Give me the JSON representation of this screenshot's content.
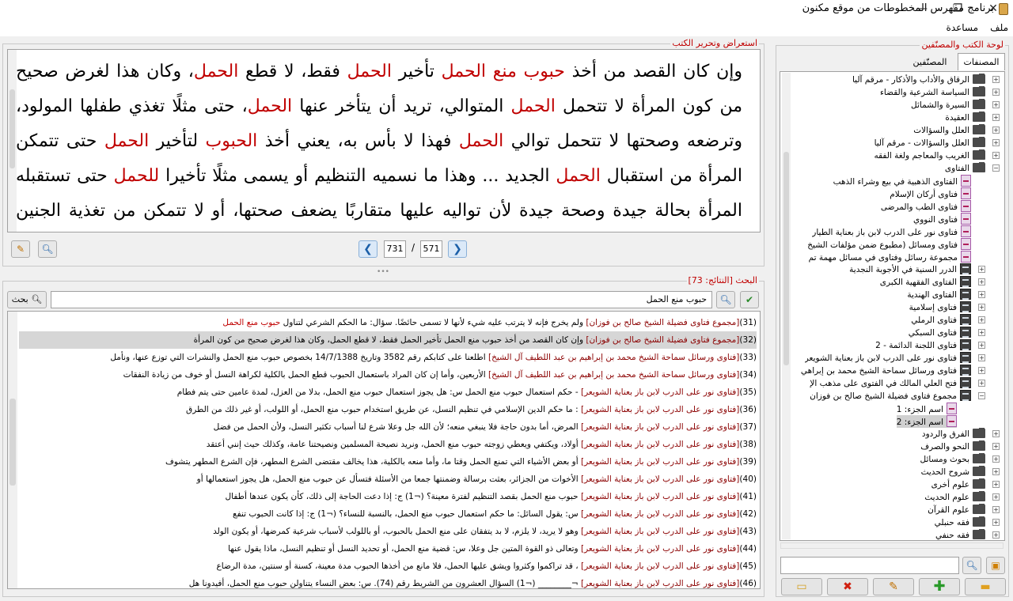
{
  "window": {
    "title": "برنامج مفهرس المخطوطات من موقع مكنون",
    "minimize": "—",
    "maximize": "❐",
    "close": "✕"
  },
  "menu": [
    "ملف",
    "مساعدة"
  ],
  "viewer": {
    "legend": "استعراض وتحرير الكتب",
    "paragraph": [
      {
        "t": "وإن كان القصد من أخذ "
      },
      {
        "t": "حبوب منع الحمل",
        "h": 1
      },
      {
        "t": " تأخير "
      },
      {
        "t": "الحمل",
        "h": 1
      },
      {
        "t": " فقط، لا قطع "
      },
      {
        "t": "الحمل",
        "h": 1
      },
      {
        "t": "، وكان هذا لغرض صحيح من كون المرأة لا تتحمل "
      },
      {
        "t": "الحمل",
        "h": 1
      },
      {
        "t": " المتوالي، تريد أن يتأخر عنها "
      },
      {
        "t": "الحمل",
        "h": 1
      },
      {
        "t": "، حتى مثلًا تغذي طفلها المولود، وترضعه وصحتها لا تتحمل توالي "
      },
      {
        "t": "الحمل",
        "h": 1
      },
      {
        "t": " فهذا لا بأس به، يعني أخذ "
      },
      {
        "t": "الحبوب",
        "h": 1
      },
      {
        "t": " لتأخير "
      },
      {
        "t": "الحمل",
        "h": 1
      },
      {
        "t": " حتى تتمكن المرأة من استقبال "
      },
      {
        "t": "الحمل",
        "h": 1
      },
      {
        "t": " الجديد ... وهذا ما نسميه التنظيم أو يسمى مثلًا تأخيرا "
      },
      {
        "t": "للحمل",
        "h": 1
      },
      {
        "t": " حتى تستقبله المرأة بحالة جيدة وصحة جيدة لأن تواليه عليها متقاربًا يضعف صحتها، أو لا تتمكن من تغذية الجنين التغذية المطلوبة، ففي هذه الحالة جائز ولا بأس به."
      }
    ],
    "page_current": "571",
    "page_sep": "/",
    "page_total": "731"
  },
  "search": {
    "legend": "البحث [النتائج: 73]",
    "query": "حبوب منع الحمل",
    "button_label": "بحث",
    "results": [
      {
        "n": "(31)",
        "src": "[مجموع فتاوى فضيلة الشيخ صالح بن فوزان]",
        "t": " ولم يخرج فإنه لا يترتب عليه شيء لأنها لا تسمى حائضًا. سؤال: ما الحكم الشرعي لتناول ",
        "k": "حبوب منع الحمل"
      },
      {
        "n": "(32)",
        "src": "[مجموع فتاوى فضيلة الشيخ صالح بن فوزان]",
        "t": " وإن كان القصد من أخذ حبوب منع الحمل تأخير الحمل فقط، لا قطع الحمل، وكان هذا لغرض صحيح من كون المرأة",
        "k": "",
        "sel": 1
      },
      {
        "n": "(33)",
        "src": "[فتاوى ورسائل سماحة الشيخ محمد بن إبراهيم بن عبد اللطيف آل الشيخ]",
        "t": " اطلعنا على كتابكم رقم 3582 وتاريخ 14/7/1388 بخصوص حبوب منع الحمل والنشرات التي توزع عنها، ونأمل",
        "k": ""
      },
      {
        "n": "(34)",
        "src": "[فتاوى ورسائل سماحة الشيخ محمد بن إبراهيم بن عبد اللطيف آل الشيخ]",
        "t": " الأربعين، وأما إن كان المراد باستعمال الحبوب قطع الحمل بالكلية لكراهة النسل أو خوف من زيادة النفقات",
        "k": ""
      },
      {
        "n": "(35)",
        "src": "[فتاوى نور على الدرب لابن باز بعناية الشويعر]",
        "t": " - حكم استعمال حبوب منع الحمل س: هل يجوز استعمال حبوب منع الحمل، بدلا من العزل، لمدة عامين حتى يتم فطام",
        "k": ""
      },
      {
        "n": "(36)",
        "src": "[فتاوى نور على الدرب لابن باز بعناية الشويعر]",
        "t": " : ما حكم الدين الإسلامي في تنظيم النسل، عن طريق استخدام حبوب منع الحمل، أو اللولب، أو غير ذلك من الطرق",
        "k": ""
      },
      {
        "n": "(37)",
        "src": "[فتاوى نور على الدرب لابن باز بعناية الشويعر]",
        "t": " المرض، أما بدون حاجة فلا ينبغي منعه؛ لأن الله جل وعلا شرع لنا أسباب تكثير النسل، ولأن الحمل من فضل",
        "k": ""
      },
      {
        "n": "(38)",
        "src": "[فتاوى نور على الدرب لابن باز بعناية الشويعر]",
        "t": " أولاد، ويكتفي ويعطي زوجته حبوب منع الحمل، ونريد نصيحة المسلمين ونصيحتنا عامة، وكذلك حيث إنني أعتقد",
        "k": ""
      },
      {
        "n": "(39)",
        "src": "[فتاوى نور على الدرب لابن باز بعناية الشويعر]",
        "t": " أو بعض الأشياء التي تمنع الحمل وقتا ما، وأما منعه بالكلية، هذا يخالف مقتضى الشرع المطهر، فإن الشرع المطهر يتشوف",
        "k": ""
      },
      {
        "n": "(40)",
        "src": "[فتاوى نور على الدرب لابن باز بعناية الشويعر]",
        "t": " الأخوات من الجزائر، بعثت برسالة وضمنتها جمعا من الأسئلة فتسأل عن حبوب منع الحمل، هل يجوز استعمالها أو",
        "k": ""
      },
      {
        "n": "(41)",
        "src": "[فتاوى نور على الدرب لابن باز بعناية الشويعر]",
        "t": " حبوب منع الحمل بقصد التنظيم لفترة معينة؟ (¬1) ج: إذا دعت الحاجة إلى ذلك، كأن يكون عندها أطفال",
        "k": ""
      },
      {
        "n": "(42)",
        "src": "[فتاوى نور على الدرب لابن باز بعناية الشويعر]",
        "t": " س: يقول السائل: ما حكم استعمال حبوب منع الحمل، بالنسبة للنساء؟ (¬1) ج: إذا كانت الحبوب تنفع",
        "k": ""
      },
      {
        "n": "(43)",
        "src": "[فتاوى نور على الدرب لابن باز بعناية الشويعر]",
        "t": " وهو لا يريد، لا يلزم، لا بد يتفقان على منع الحمل بالحبوب، أو باللولب لأسباب شرعية كمرضها، أو يكون الولد",
        "k": ""
      },
      {
        "n": "(44)",
        "src": "[فتاوى نور على الدرب لابن باز بعناية الشويعر]",
        "t": " وتعالى ذو القوة المتين جل وعلا، س: قضية منع الحمل، أو تحديد النسل أو تنظيم النسل، ماذا يقول عنها",
        "k": ""
      },
      {
        "n": "(45)",
        "src": "[فتاوى نور على الدرب لابن باز بعناية الشويعر]",
        "t": " ، قد تراكموا وكثروا ويشق عليها الحمل، فلا مانع من أخذها الحبوب مدة معينة، كسنة أو سنتين، مدة الرضاع",
        "k": ""
      },
      {
        "n": "(46)",
        "src": "[فتاوى نور على الدرب لابن باز بعناية الشويعر]",
        "t": " ¬________ (¬1) السؤال العشرون من الشريط رقم (74). س: بعض النساء يتناولن حبوب منع الحمل، أفيدونا هل",
        "k": ""
      }
    ]
  },
  "library": {
    "legend": "لوحة الكتب والمصنّفين",
    "tabs": [
      "المصنفات",
      "المصنّفين"
    ],
    "tree": [
      {
        "l": "الرقاق والأداب والأذكار - مرقم آليا",
        "i": "folder",
        "d": 0
      },
      {
        "l": "السياسة الشرعية والقضاء",
        "i": "folder",
        "d": 0
      },
      {
        "l": "السيرة والشمائل",
        "i": "folder",
        "d": 0
      },
      {
        "l": "العقيدة",
        "i": "folder",
        "d": 0
      },
      {
        "l": "العلل والسؤالات",
        "i": "folder",
        "d": 0
      },
      {
        "l": "العلل والسؤالات - مرقم آليا",
        "i": "folder",
        "d": 0
      },
      {
        "l": "الغريب والمعاجم ولغة الفقه",
        "i": "folder",
        "d": 0
      },
      {
        "l": "الفتاوى",
        "i": "folder",
        "d": 0,
        "open": 1
      },
      {
        "l": "الفتاوى الذهبية في بيع وشراء الذهب",
        "i": "book",
        "d": 1
      },
      {
        "l": "فتاوى أركان الإسلام",
        "i": "book",
        "d": 1
      },
      {
        "l": "فتاوى الطب والمرضى",
        "i": "book",
        "d": 1
      },
      {
        "l": "فتاوى النووي",
        "i": "book",
        "d": 1
      },
      {
        "l": "فتاوى نور على الدرب لابن باز بعناية الطيار",
        "i": "book",
        "d": 1
      },
      {
        "l": "فتاوى ومسائل (مطبوع ضمن مؤلفات الشيخ",
        "i": "book",
        "d": 1
      },
      {
        "l": "مجموعة رسائل وفتاوى في مسائل مهمة تم",
        "i": "book",
        "d": 1
      },
      {
        "l": "الدرر السنية في الأجوبة النجدية",
        "i": "dark",
        "d": 1
      },
      {
        "l": "الفتاوى الفقهية الكبرى",
        "i": "dark",
        "d": 1
      },
      {
        "l": "الفتاوى الهندية",
        "i": "dark",
        "d": 1
      },
      {
        "l": "فتاوى إسلامية",
        "i": "dark",
        "d": 1
      },
      {
        "l": "فتاوى الرملي",
        "i": "dark",
        "d": 1
      },
      {
        "l": "فتاوى السبكي",
        "i": "dark",
        "d": 1
      },
      {
        "l": "فتاوى اللجنة الدائمة - 2",
        "i": "dark",
        "d": 1
      },
      {
        "l": "فتاوى نور على الدرب لابن باز بعناية الشويعر",
        "i": "dark",
        "d": 1
      },
      {
        "l": "فتاوى ورسائل سماحة الشيخ محمد بن إبراهي",
        "i": "dark",
        "d": 1
      },
      {
        "l": "فتح العلي المالك في الفتوى على مذهب الإ",
        "i": "dark",
        "d": 1
      },
      {
        "l": "مجموع فتاوى فضيلة الشيخ صالح بن فوزان",
        "i": "dark",
        "d": 1,
        "open": 1
      },
      {
        "l": "اسم الجزء: 1",
        "i": "book",
        "d": 2
      },
      {
        "l": "اسم الجزء: 2",
        "i": "book",
        "d": 2,
        "sel": 1
      },
      {
        "l": "الفرق والردود",
        "i": "folder",
        "d": 0
      },
      {
        "l": "النحو والصرف",
        "i": "folder",
        "d": 0
      },
      {
        "l": "بحوث ومسائل",
        "i": "folder",
        "d": 0
      },
      {
        "l": "شروح الحديث",
        "i": "folder",
        "d": 0
      },
      {
        "l": "علوم أخرى",
        "i": "folder",
        "d": 0
      },
      {
        "l": "علوم الحديث",
        "i": "folder",
        "d": 0
      },
      {
        "l": "علوم القرآن",
        "i": "folder",
        "d": 0
      },
      {
        "l": "فقه حنبلي",
        "i": "folder",
        "d": 0
      },
      {
        "l": "فقه حنفي",
        "i": "folder",
        "d": 0
      }
    ],
    "filter_value": ""
  },
  "colors": {
    "highlight": "#c00000",
    "legend": "#c00000",
    "selection": "#d6d6d6"
  }
}
